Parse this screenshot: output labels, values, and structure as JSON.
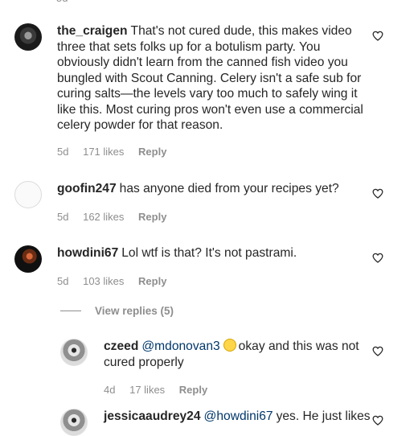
{
  "comments": [
    {
      "username": "the_craigen",
      "text": "That's not cured dude, this makes video three that sets folks up for a botulism party. You obviously didn't learn from the canned fish video you bungled with Scout Canning. Celery isn't a safe sub for curing salts—the levels vary too much to safely wing it like this. Most curing pros won't even use a commercial celery powder for that reason.",
      "age": "5d",
      "likes": "171 likes",
      "reply": "Reply"
    },
    {
      "username": "goofin247",
      "text": "has anyone died from your recipes yet?",
      "age": "5d",
      "likes": "162 likes",
      "reply": "Reply"
    },
    {
      "username": "howdini67",
      "text": "Lol wtf is that? It's not pastrami.",
      "age": "5d",
      "likes": "103 likes",
      "reply": "Reply"
    }
  ],
  "view_replies": "View replies (5)",
  "replies": [
    {
      "username": "czeed",
      "mention": "@mdonovan3",
      "emoji": "slightly-smiling-face",
      "text": "okay and this was not cured properly",
      "age": "4d",
      "likes": "17 likes",
      "reply": "Reply"
    },
    {
      "username": "jessicaaudrey24",
      "mention": "@howdini67",
      "text": "yes. He just likes"
    }
  ],
  "icons": {
    "like": "heart-outline-icon"
  },
  "colors": {
    "text": "#262626",
    "meta": "#8e8e8e",
    "mention": "#00376b"
  }
}
